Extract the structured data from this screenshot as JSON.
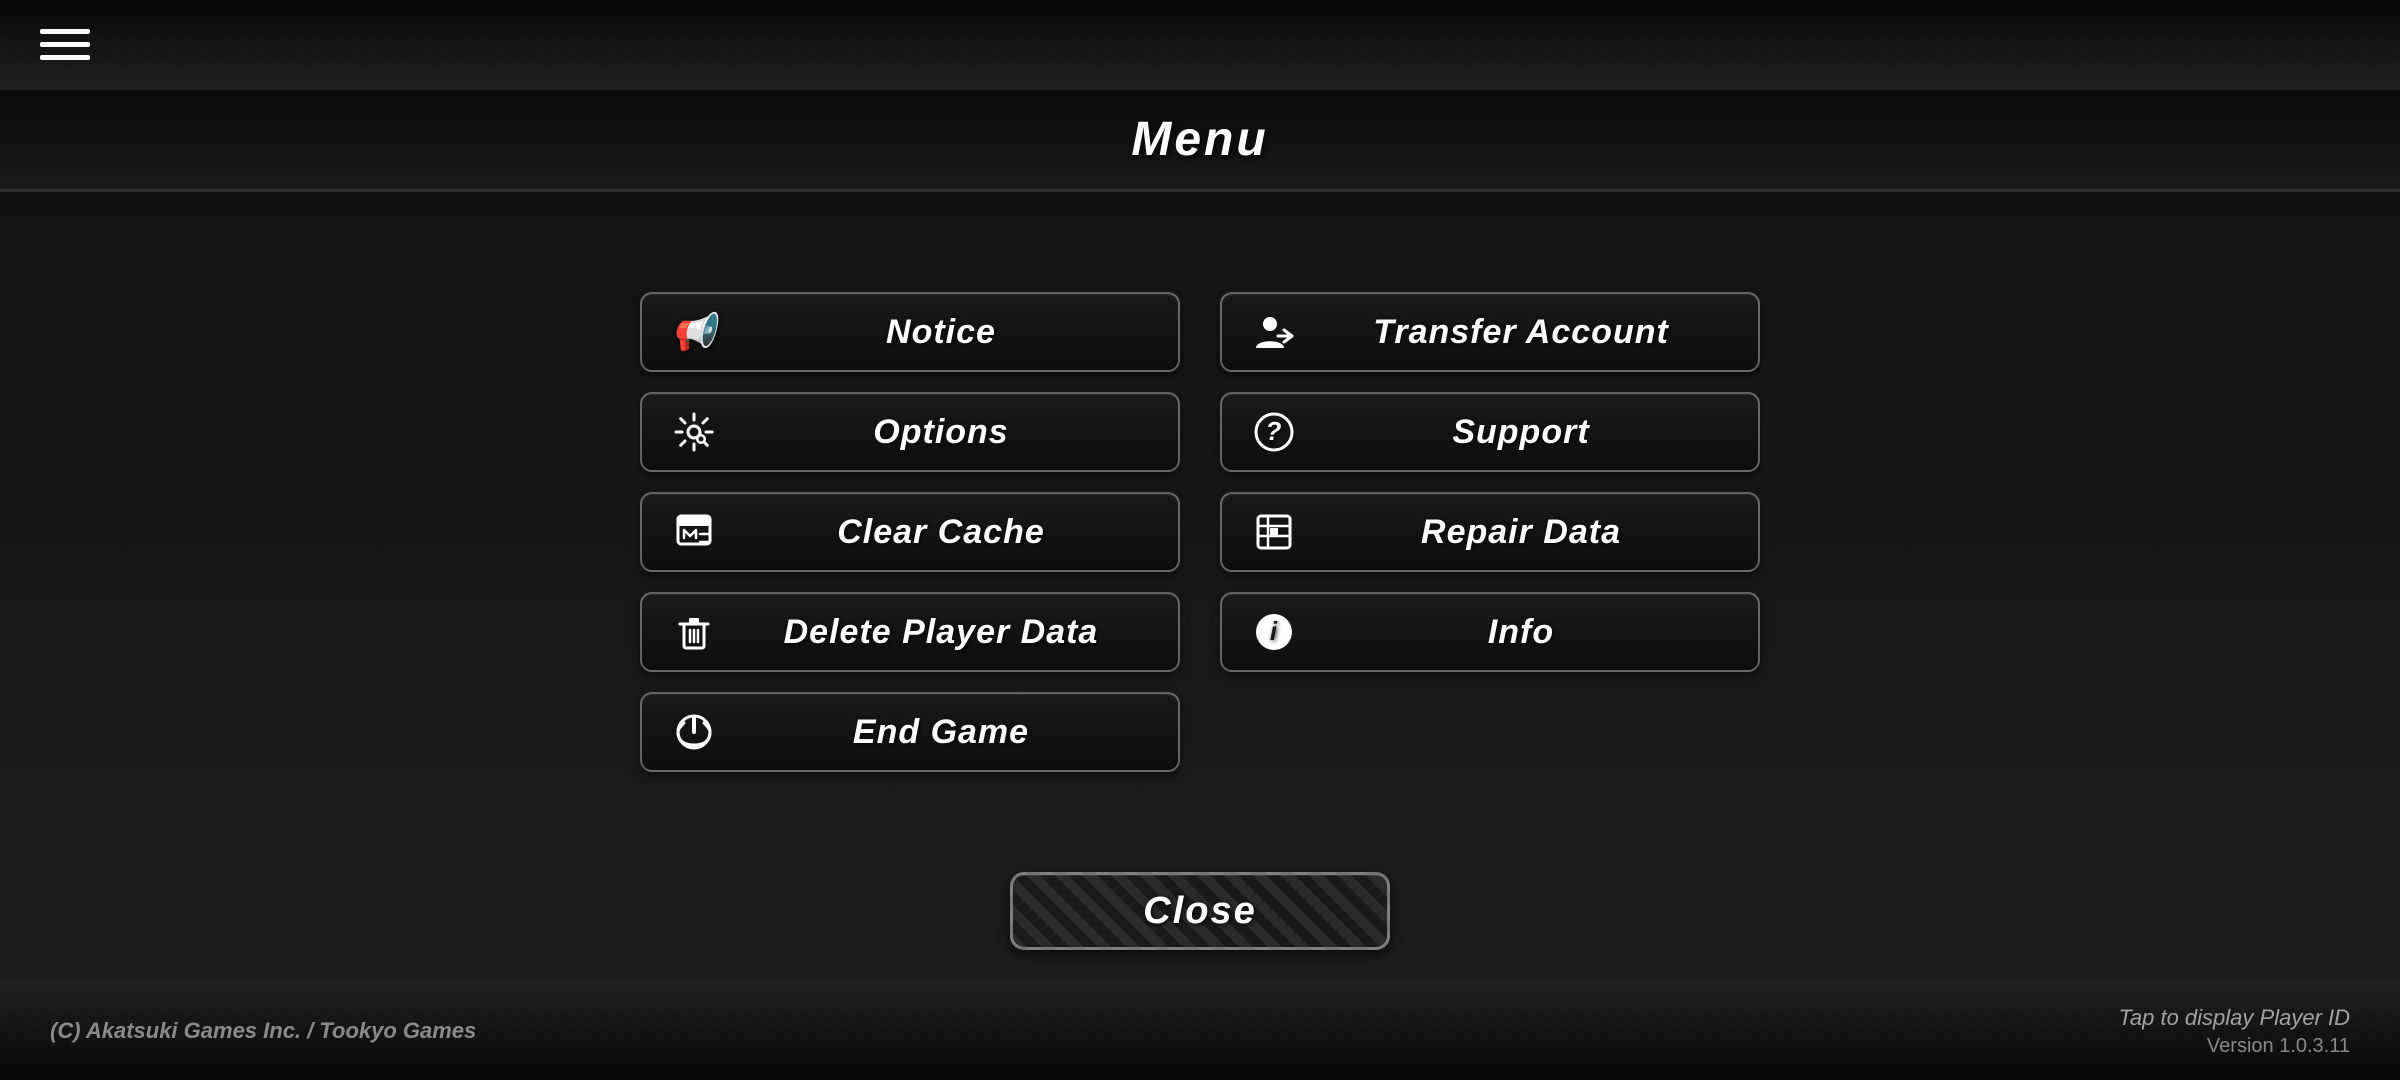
{
  "background": {
    "color": "#222222"
  },
  "top_bar": {
    "hamburger_label": "hamburger menu"
  },
  "menu": {
    "title": "Menu",
    "buttons_left": [
      {
        "id": "notice",
        "icon": "📢",
        "label": "Notice"
      },
      {
        "id": "options",
        "icon": "⚙",
        "label": "Options"
      },
      {
        "id": "clear-cache",
        "icon": "🗂",
        "label": "Clear Cache"
      },
      {
        "id": "delete-player-data",
        "icon": "🗑",
        "label": "Delete Player Data"
      },
      {
        "id": "end-game",
        "icon": "⏻",
        "label": "End Game"
      }
    ],
    "buttons_right": [
      {
        "id": "transfer-account",
        "icon": "👤",
        "label": "Transfer Account"
      },
      {
        "id": "support",
        "icon": "❓",
        "label": "Support"
      },
      {
        "id": "repair-data",
        "icon": "📋",
        "label": "Repair Data"
      },
      {
        "id": "info",
        "icon": "ℹ",
        "label": "Info"
      }
    ],
    "close_button_label": "Close"
  },
  "bottom_bar": {
    "copyright": "(C) Akatsuki Games Inc. / Tookyo Games",
    "tap_player_id": "Tap to display Player ID",
    "version": "Version 1.0.3.11"
  }
}
